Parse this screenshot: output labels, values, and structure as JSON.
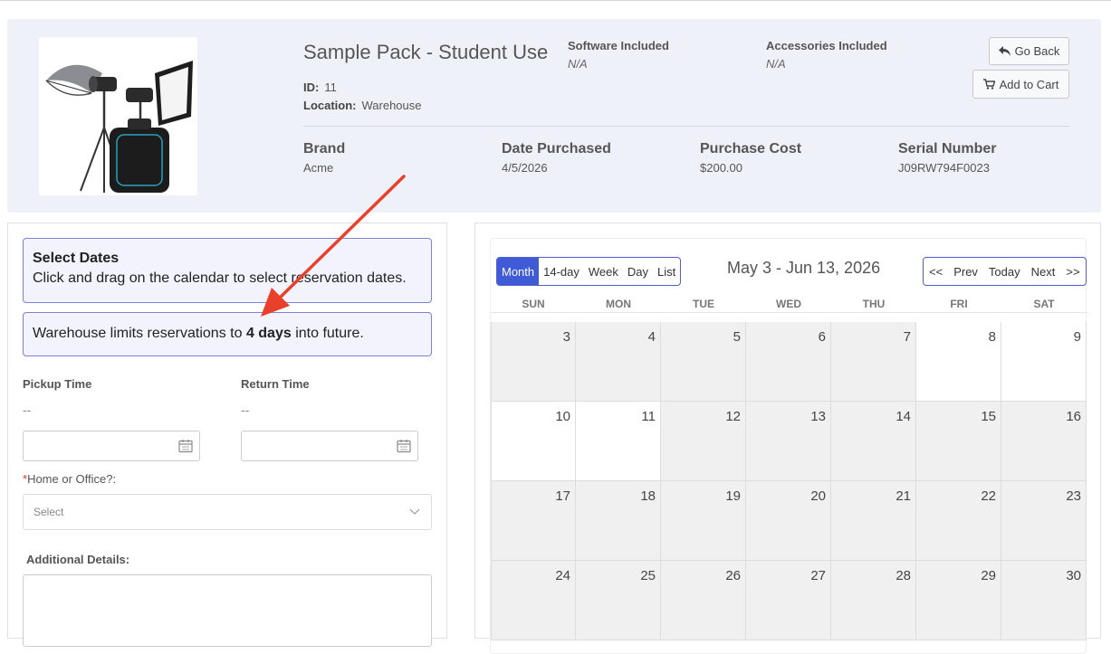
{
  "product": {
    "title": "Sample Pack - Student Use",
    "id_label": "ID:",
    "id_value": "11",
    "location_label": "Location:",
    "location_value": "Warehouse",
    "software_label": "Software Included",
    "software_value": "N/A",
    "accessories_label": "Accessories Included",
    "accessories_value": "N/A",
    "details": [
      {
        "label": "Brand",
        "value": "Acme"
      },
      {
        "label": "Date Purchased",
        "value": "4/5/2026"
      },
      {
        "label": "Purchase Cost",
        "value": "$200.00"
      },
      {
        "label": "Serial Number",
        "value": "J09RW794F0023"
      }
    ]
  },
  "buttons": {
    "go_back": "Go Back",
    "add_to_cart": "Add to Cart"
  },
  "icons": {
    "go_back": "reply-arrow-icon",
    "add_to_cart": "cart-icon",
    "calendar": "calendar-icon",
    "chevron": "chevron-down-icon"
  },
  "reservation": {
    "select_dates_title": "Select Dates",
    "select_dates_text": "Click and drag on the calendar to select reservation dates.",
    "limit_prefix": "Warehouse limits reservations to ",
    "limit_bold": "4 days",
    "limit_suffix": " into future.",
    "pickup_label": "Pickup Time",
    "pickup_value": "--",
    "return_label": "Return Time",
    "return_value": "--",
    "home_office_star": "*",
    "home_office_label": "Home or Office?:",
    "select_placeholder": "Select",
    "additional_label": "Additional Details:"
  },
  "calendar": {
    "views": [
      "Month",
      "14-day",
      "Week",
      "Day",
      "List"
    ],
    "active_view": "Month",
    "title": "May 3 - Jun 13, 2026",
    "nav": [
      "<<",
      "Prev",
      "Today",
      "Next",
      ">>"
    ],
    "days_of_week": [
      "SUN",
      "MON",
      "TUE",
      "WED",
      "THU",
      "FRI",
      "SAT"
    ],
    "weeks": [
      [
        3,
        4,
        5,
        6,
        7,
        8,
        9
      ],
      [
        10,
        11,
        12,
        13,
        14,
        15,
        16
      ],
      [
        17,
        18,
        19,
        20,
        21,
        22,
        23
      ],
      [
        24,
        25,
        26,
        27,
        28,
        29,
        30
      ]
    ],
    "available_days": [
      8,
      9,
      10,
      11
    ]
  },
  "colors": {
    "accent": "#3f5bd8",
    "annotation_arrow": "#e8402a",
    "header_bg": "#eef2f8",
    "info_box_border": "#7b83d6"
  }
}
